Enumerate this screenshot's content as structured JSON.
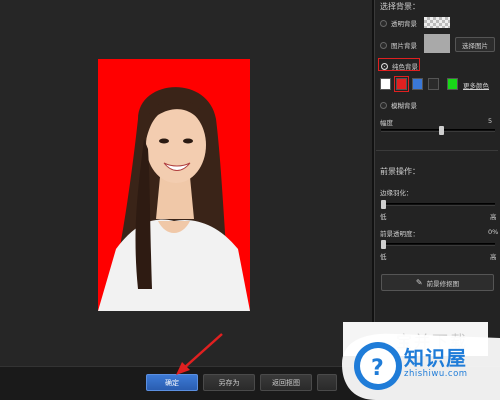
{
  "sidebar": {
    "choose_bg_title": "选择背景：",
    "transparent_bg": "透明背景",
    "image_bg": "图片背景",
    "select_image_button": "选择图片",
    "solid_bg": "纯色背景",
    "more_colors": "更多颜色",
    "blur_bg": "模糊背景",
    "amplitude_label": "幅度",
    "amplitude_value": "5",
    "foreground_title": "前景操作：",
    "edge_feather_label": "边缘羽化：",
    "edge_low": "低",
    "edge_high": "高",
    "fg_opacity_label": "前景透明度：",
    "fg_opacity_value": "0%",
    "opacity_low": "低",
    "opacity_high": "高",
    "fg_cutout_button": "前景修抠图"
  },
  "colors": {
    "swatches": [
      "#ffffff",
      "#e02020",
      "#3a78d8",
      "#2b2b2b",
      "#18d818"
    ],
    "selected_swatch": "#e02020",
    "photo_background": "#ff0000",
    "accent": "#2a5db0"
  },
  "sliders": {
    "amplitude": 0.53,
    "edge_feather": 0.0,
    "fg_opacity": 0.0
  },
  "bottom": {
    "confirm": "确定",
    "save_as": "另存为",
    "back_to_cutout": "返回抠图"
  },
  "watermark": {
    "ghost_text": "宝并下载",
    "brand_cn": "知识屋",
    "brand_url": "zhishiwu.com"
  }
}
